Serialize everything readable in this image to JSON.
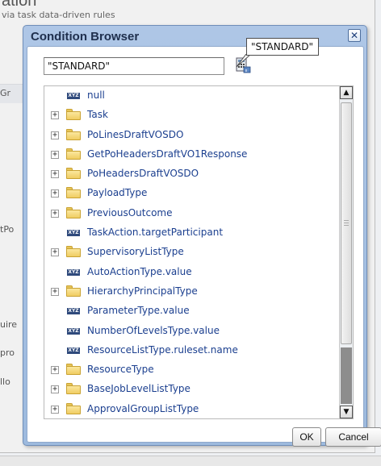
{
  "background": {
    "title_fragment": "ation",
    "subtitle_fragment": "via task data-driven rules",
    "side_labels": [
      "Gr",
      "tPo",
      "uire",
      "pro",
      "llo"
    ]
  },
  "dialog": {
    "title": "Condition Browser",
    "close_glyph": "✕",
    "search": {
      "value": "\"STANDARD\""
    },
    "tooltip": "\"STANDARD\"",
    "tree": {
      "items": [
        {
          "label": "null",
          "icon": "xyz-variable-icon",
          "expandable": false
        },
        {
          "label": "Task",
          "icon": "folder-icon",
          "expandable": true
        },
        {
          "label": "PoLinesDraftVOSDO",
          "icon": "folder-icon",
          "expandable": true
        },
        {
          "label": "GetPoHeadersDraftVO1Response",
          "icon": "folder-icon",
          "expandable": true
        },
        {
          "label": "PoHeadersDraftVOSDO",
          "icon": "folder-icon",
          "expandable": true
        },
        {
          "label": "PayloadType",
          "icon": "folder-icon",
          "expandable": true
        },
        {
          "label": "PreviousOutcome",
          "icon": "folder-icon",
          "expandable": true
        },
        {
          "label": "TaskAction.targetParticipant",
          "icon": "xyz-variable-icon",
          "expandable": false
        },
        {
          "label": "SupervisoryListType",
          "icon": "folder-icon",
          "expandable": true
        },
        {
          "label": "AutoActionType.value",
          "icon": "xyz-variable-icon",
          "expandable": false
        },
        {
          "label": "HierarchyPrincipalType",
          "icon": "folder-icon",
          "expandable": true
        },
        {
          "label": "ParameterType.value",
          "icon": "xyz-variable-icon",
          "expandable": false
        },
        {
          "label": "NumberOfLevelsType.value",
          "icon": "xyz-variable-icon",
          "expandable": false
        },
        {
          "label": "ResourceListType.ruleset.name",
          "icon": "xyz-variable-icon",
          "expandable": false
        },
        {
          "label": "ResourceType",
          "icon": "folder-icon",
          "expandable": true
        },
        {
          "label": "BaseJobLevelListType",
          "icon": "folder-icon",
          "expandable": true
        },
        {
          "label": "ApprovalGroupListType",
          "icon": "folder-icon",
          "expandable": true
        }
      ],
      "expander_glyph": "+",
      "xyz_text": "XYZ"
    },
    "buttons": {
      "ok": "OK",
      "cancel": "Cancel"
    }
  },
  "colors": {
    "dialog_frame": "#9dbade",
    "tree_label": "#1b3f8f",
    "folder": "#f0cd62"
  }
}
